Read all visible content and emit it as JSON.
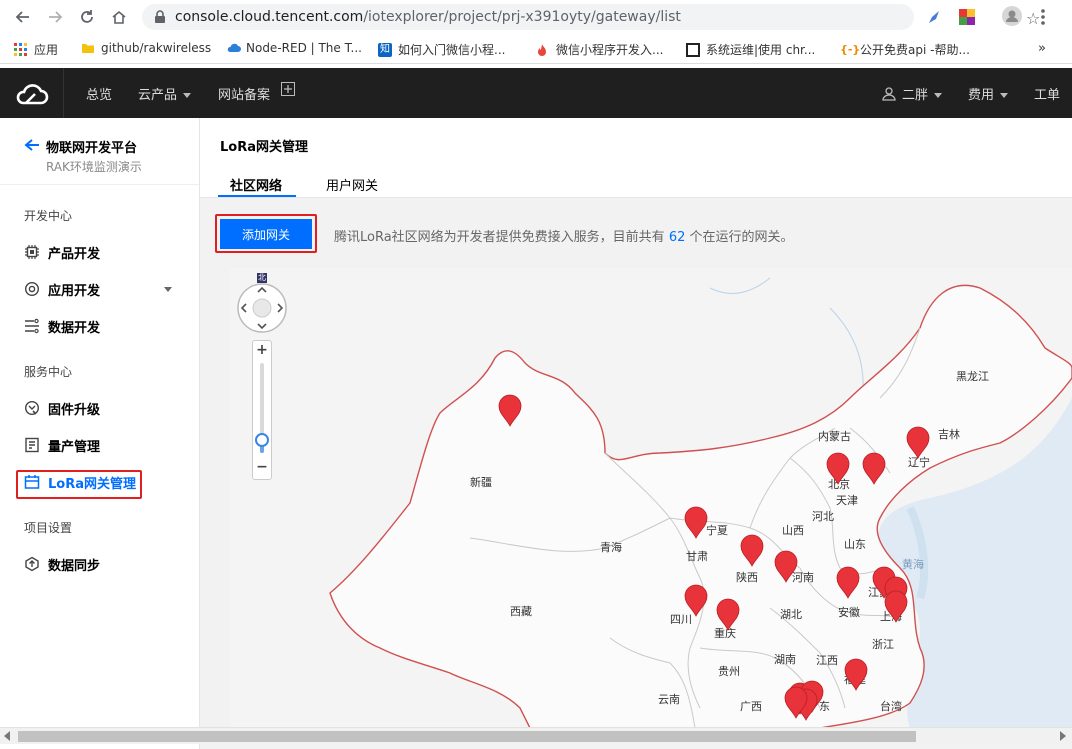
{
  "browser": {
    "url_host": "console.cloud.tencent.com",
    "url_path": "/iotexplorer/project/prj-x391oyty/gateway/list",
    "bookmarks": [
      {
        "label": "应用"
      },
      {
        "label": "github/rakwireless"
      },
      {
        "label": "Node-RED | The T..."
      },
      {
        "label": "如何入门微信小程..."
      },
      {
        "label": "微信小程序开发入..."
      },
      {
        "label": "系统运维|使用 chr..."
      },
      {
        "label": "公开免费api -帮助..."
      }
    ],
    "more_bookmarks": "»"
  },
  "topnav": {
    "items": [
      "总览",
      "云产品",
      "网站备案"
    ],
    "user": "二胖",
    "billing": "费用",
    "ticket": "工单"
  },
  "sidebar": {
    "platform_title": "物联网开发平台",
    "project_name": "RAK环境监测演示",
    "sections": [
      {
        "label": "开发中心"
      },
      {
        "label": "服务中心"
      },
      {
        "label": "项目设置"
      }
    ],
    "items": [
      {
        "label": "产品开发"
      },
      {
        "label": "应用开发"
      },
      {
        "label": "数据开发"
      },
      {
        "label": "固件升级"
      },
      {
        "label": "量产管理"
      },
      {
        "label": "LoRa网关管理"
      },
      {
        "label": "数据同步"
      }
    ]
  },
  "page": {
    "title": "LoRa网关管理",
    "tabs": [
      "社区网络",
      "用户网关"
    ],
    "add_button": "添加网关",
    "intro_prefix": "腾讯LoRa社区网络为开发者提供免费接入服务，目前共有 ",
    "gateway_count": "62",
    "intro_suffix": " 个在运行的网关。"
  },
  "map": {
    "compass_label": "北",
    "zoom_in": "+",
    "zoom_out": "−",
    "zoom_level": 0.15,
    "provinces": [
      "黑龙江",
      "吉林",
      "内蒙古",
      "辽宁",
      "北京",
      "天津",
      "新疆",
      "宁夏",
      "山西",
      "河北",
      "山东",
      "青海",
      "甘肃",
      "陕西",
      "河南",
      "江苏",
      "安徽",
      "上海",
      "西藏",
      "四川",
      "重庆",
      "湖北",
      "浙江",
      "贵州",
      "湖南",
      "江西",
      "福建",
      "云南",
      "广西",
      "广东",
      "台湾"
    ],
    "sea_label": "黄海"
  },
  "colors": {
    "accent": "#006eff",
    "highlight_border": "#e02020",
    "topnav_bg": "#1f1f1f",
    "marker": "#e8333a"
  }
}
